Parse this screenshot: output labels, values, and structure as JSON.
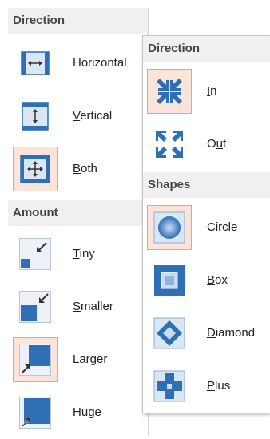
{
  "direction_menu": {
    "header": "Direction",
    "items": [
      {
        "pre": "Horizontal",
        "u": "",
        "post": ""
      },
      {
        "pre": "",
        "u": "V",
        "post": "ertical"
      },
      {
        "pre": "",
        "u": "B",
        "post": "oth"
      }
    ]
  },
  "amount_menu": {
    "header": "Amount",
    "items": [
      {
        "pre": "",
        "u": "T",
        "post": "iny"
      },
      {
        "pre": "",
        "u": "S",
        "post": "maller"
      },
      {
        "pre": "",
        "u": "L",
        "post": "arger"
      },
      {
        "pre": "Hu",
        "u": "g",
        "post": "e"
      }
    ]
  },
  "sub_direction_menu": {
    "header": "Direction",
    "items": [
      {
        "pre": "",
        "u": "I",
        "post": "n"
      },
      {
        "pre": "O",
        "u": "u",
        "post": "t"
      }
    ]
  },
  "shapes_menu": {
    "header": "Shapes",
    "items": [
      {
        "pre": "",
        "u": "C",
        "post": "ircle"
      },
      {
        "pre": "",
        "u": "B",
        "post": "ox"
      },
      {
        "pre": "",
        "u": "D",
        "post": "iamond"
      },
      {
        "pre": "",
        "u": "P",
        "post": "lus"
      }
    ]
  },
  "icons": {
    "horizontal": "horizontal-arrows-icon",
    "vertical": "vertical-arrows-icon",
    "both": "four-way-arrows-icon",
    "tiny": "tiny-square-icon",
    "smaller": "smaller-square-icon",
    "larger": "larger-square-icon",
    "huge": "huge-square-icon",
    "in": "arrows-in-icon",
    "out": "arrows-out-icon",
    "circle": "circle-shape-icon",
    "box": "box-shape-icon",
    "diamond": "diamond-shape-icon",
    "plus": "plus-shape-icon"
  },
  "colors": {
    "accent_blue": "#2e6fb5",
    "selected_bg": "#fde4d8",
    "selected_border": "#f0a07a",
    "header_bg": "#f0f0f0"
  }
}
